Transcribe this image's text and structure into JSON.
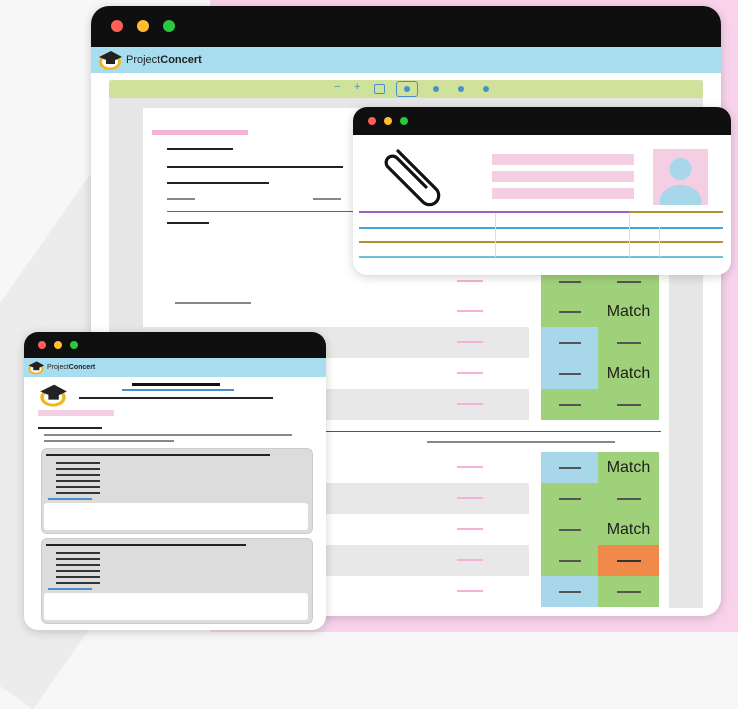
{
  "main_window": {
    "app_name_prefix": "Project",
    "app_name_bold": "Concert",
    "toolbar": {
      "zoom_out": "−",
      "zoom_in": "+"
    }
  },
  "grid": {
    "match_label": "Match",
    "rows": [
      {
        "left": "green",
        "right": "green",
        "right_text": ""
      },
      {
        "left": "green",
        "right": "green",
        "right_text": "Match"
      },
      {
        "left": "blue",
        "right": "green",
        "right_text": ""
      },
      {
        "left": "blue",
        "right": "green",
        "right_text": "Match"
      },
      {
        "left": "green",
        "right": "green",
        "right_text": ""
      },
      {
        "left": "blue",
        "right": "green",
        "right_text": "Match"
      },
      {
        "left": "green",
        "right": "green",
        "right_text": ""
      },
      {
        "left": "green",
        "right": "green",
        "right_text": "Match"
      },
      {
        "left": "green",
        "right": "orange",
        "right_text": ""
      },
      {
        "left": "blue",
        "right": "green",
        "right_text": ""
      }
    ]
  },
  "small_window": {
    "app_name_prefix": "Project",
    "app_name_bold": "Concert"
  },
  "colors": {
    "titlebar": "#0f0f0f",
    "appbar": "#a8dcef",
    "toolbar": "#cfe29a",
    "cell_green": "#9fd17a",
    "cell_blue": "#a8d7ea",
    "cell_orange": "#f08a4b",
    "pink_accent": "#f4b3d6"
  },
  "icons": [
    "paperclip-icon",
    "avatar-placeholder-icon",
    "graduation-cap-logo-icon"
  ]
}
